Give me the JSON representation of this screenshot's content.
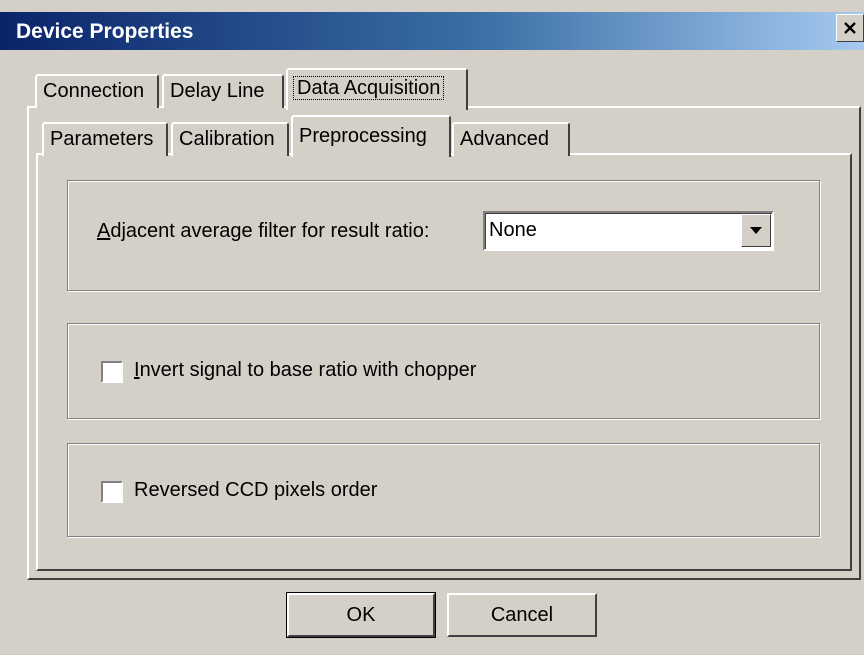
{
  "window": {
    "title": "Device Properties",
    "close_icon": "close-icon"
  },
  "main_tabs": [
    {
      "label": "Connection",
      "active": false
    },
    {
      "label": "Delay Line",
      "active": false
    },
    {
      "label": "Data Acquisition",
      "active": true
    }
  ],
  "sub_tabs": [
    {
      "label": "Parameters",
      "active": false
    },
    {
      "label": "Calibration",
      "active": false
    },
    {
      "label": "Preprocessing",
      "active": true
    },
    {
      "label": "Advanced",
      "active": false
    }
  ],
  "filter": {
    "label_accel": "A",
    "label_rest": "djacent average filter for result ratio:",
    "selected_value": "None"
  },
  "invert_option": {
    "label_accel": "I",
    "label_rest": "nvert signal to base ratio with chopper",
    "checked": false
  },
  "reversed_option": {
    "label": "Reversed CCD pixels order",
    "checked": false
  },
  "buttons": {
    "ok": "OK",
    "cancel": "Cancel"
  }
}
